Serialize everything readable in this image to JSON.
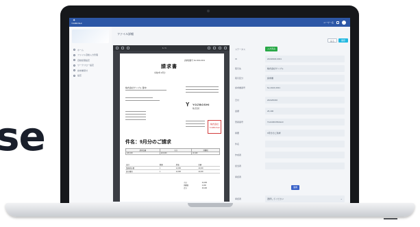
{
  "hero": {
    "partial_text": "se"
  },
  "app": {
    "logo": "YOZBOSHI",
    "header": {
      "user": "ユーザー名"
    },
    "sidebar": {
      "items": [
        {
          "label": "ホーム"
        },
        {
          "label": "ファイル自動入力管理"
        },
        {
          "label": "自動処理設定"
        },
        {
          "label": "ワークフロー設定"
        },
        {
          "label": "請求書受付"
        },
        {
          "label": "設定"
        }
      ]
    },
    "page_title": "ファイル詳細",
    "buttons": {
      "cancel": "戻る",
      "save": "保存"
    }
  },
  "viewer": {
    "page_indicator": "1 / 1"
  },
  "document": {
    "title": "請求書",
    "meta": "請求書番号 No.2024-0031",
    "period": "令和6年 9月分",
    "company": "YOZBOSHI",
    "company_sub": "株式会社",
    "client": "株式会社サンプル 御中",
    "stamp": "株式会社 YOZBOSHI",
    "subject": "件名：9月分のご請求",
    "table_headers": [
      "請求金額",
      "小計",
      "消費税"
    ],
    "table_values": [
      "¥26,400",
      "¥24,000",
      "¥2,400"
    ],
    "items": [
      [
        "品目",
        "数量",
        "単価",
        "金額"
      ],
      [
        "業務委託費",
        "1",
        "12,000",
        "12,000"
      ],
      [
        "保守費用",
        "1",
        "12,000",
        "12,000"
      ]
    ],
    "totals": [
      [
        "小計",
        "24,000"
      ],
      [
        "消費税",
        "2,400"
      ],
      [
        "合計",
        "26,400"
      ]
    ]
  },
  "form": {
    "fields": [
      {
        "label": "ステータス",
        "value": ""
      },
      {
        "label": "ID",
        "value": "20240930-0001"
      },
      {
        "label": "取引先",
        "value": "株式会社サンプル"
      },
      {
        "label": "取引区分",
        "value": "請求書"
      },
      {
        "label": "請求書番号",
        "value": "No.2024-0031"
      },
      {
        "label": "日付",
        "value": "2024/09/30"
      },
      {
        "label": "金額",
        "value": "26,400"
      },
      {
        "label": "登録番号",
        "value": "T1234567890123"
      },
      {
        "label": "摘要",
        "value": "9月分のご請求"
      },
      {
        "label": "件名",
        "value": ""
      },
      {
        "label": "作成者",
        "value": ""
      },
      {
        "label": "担当者",
        "value": ""
      },
      {
        "label": "承認者",
        "value": ""
      }
    ],
    "status_label": "入力済み",
    "apply_button": "適用",
    "select_label": "承認者",
    "select_value": "選択してください",
    "confirm_button": "確定"
  }
}
